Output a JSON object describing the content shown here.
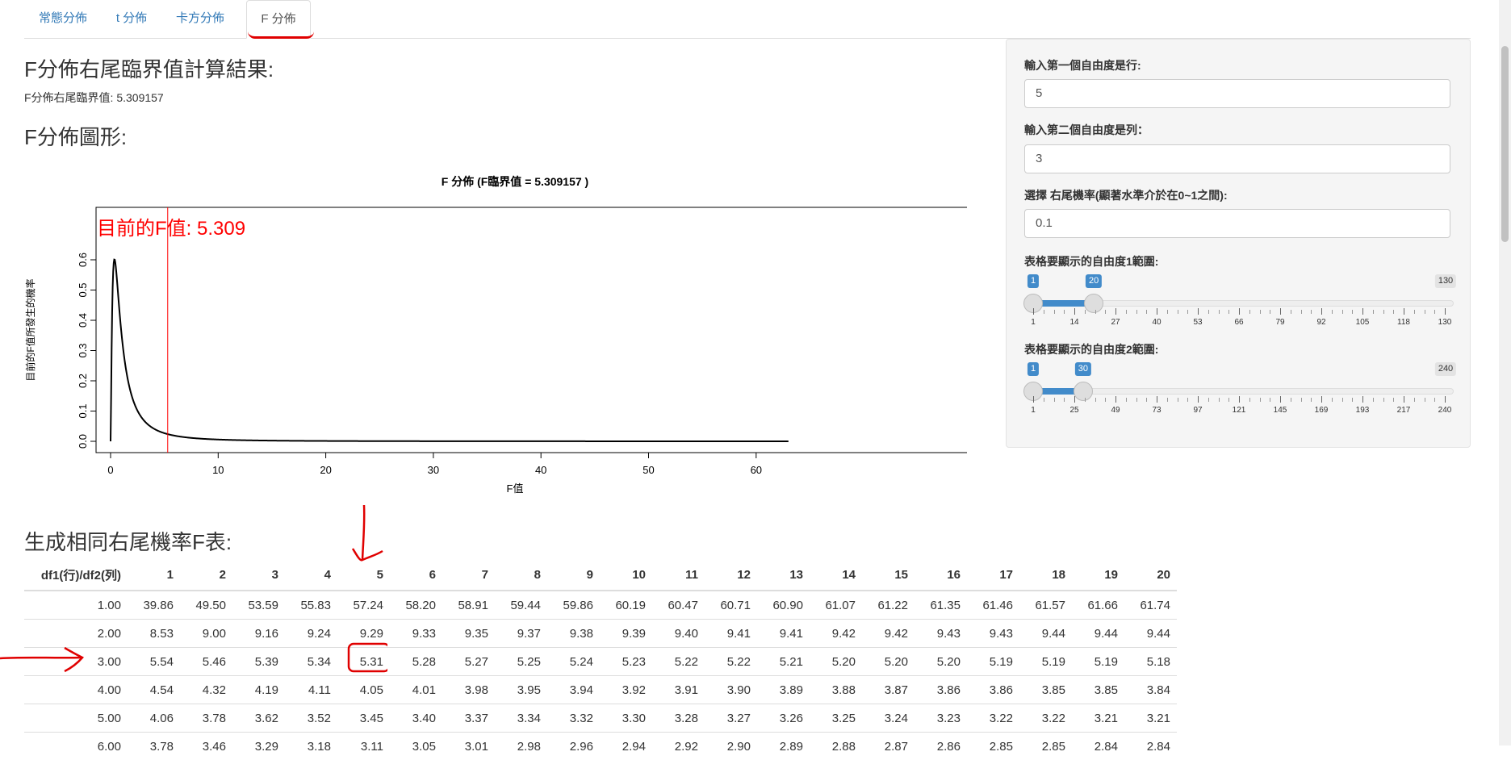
{
  "tabs": [
    {
      "label": "常態分佈"
    },
    {
      "label": "t 分佈"
    },
    {
      "label": "卡方分佈"
    },
    {
      "label": "F 分佈",
      "active": true
    }
  ],
  "main": {
    "result_heading": "F分佈右尾臨界值計算結果:",
    "result_text": "F分佈右尾臨界值: 5.309157",
    "plot_heading": "F分佈圖形:",
    "table_heading": "生成相同右尾機率F表:"
  },
  "chart_data": {
    "type": "line",
    "title": "F 分佈 (F臨界值 = 5.309157 )",
    "xlabel": "F值",
    "ylabel": "目前的F值所發生的機率",
    "annotation": "目前的F值: 5.309",
    "critical_value": 5.309157,
    "df1": 5,
    "df2": 3,
    "xlim": [
      0,
      63
    ],
    "ylim": [
      0,
      0.6
    ],
    "xticks": [
      0,
      10,
      20,
      30,
      40,
      50,
      60
    ],
    "yticks": [
      0.0,
      0.1,
      0.2,
      0.3,
      0.4,
      0.5,
      0.6
    ],
    "curve_color": "#000000",
    "line_color": "#ff0000"
  },
  "sidebar": {
    "df1_label": "輸入第一個自由度是行:",
    "df1_value": "5",
    "df2_label": "輸入第二個自由度是列：",
    "df2_value": "3",
    "prob_label": "選擇 右尾機率(顯著水準介於在0~1之間):",
    "prob_value": "0.1",
    "slider1": {
      "label": "表格要顯示的自由度1範圍:",
      "min": 1,
      "max": 130,
      "from": 1,
      "to": 20,
      "ticks": [
        "1",
        "14",
        "27",
        "40",
        "53",
        "66",
        "79",
        "92",
        "105",
        "118",
        "130"
      ]
    },
    "slider2": {
      "label": "表格要顯示的自由度2範圍:",
      "min": 1,
      "max": 240,
      "from": 1,
      "to": 30,
      "ticks": [
        "1",
        "25",
        "49",
        "73",
        "97",
        "121",
        "145",
        "169",
        "193",
        "217",
        "240"
      ]
    }
  },
  "table": {
    "header": [
      "df1(行)/df2(列)",
      "1",
      "2",
      "3",
      "4",
      "5",
      "6",
      "7",
      "8",
      "9",
      "10",
      "11",
      "12",
      "13",
      "14",
      "15",
      "16",
      "17",
      "18",
      "19",
      "20"
    ],
    "rows": [
      [
        "1.00",
        "39.86",
        "49.50",
        "53.59",
        "55.83",
        "57.24",
        "58.20",
        "58.91",
        "59.44",
        "59.86",
        "60.19",
        "60.47",
        "60.71",
        "60.90",
        "61.07",
        "61.22",
        "61.35",
        "61.46",
        "61.57",
        "61.66",
        "61.74"
      ],
      [
        "2.00",
        "8.53",
        "9.00",
        "9.16",
        "9.24",
        "9.29",
        "9.33",
        "9.35",
        "9.37",
        "9.38",
        "9.39",
        "9.40",
        "9.41",
        "9.41",
        "9.42",
        "9.42",
        "9.43",
        "9.43",
        "9.44",
        "9.44",
        "9.44"
      ],
      [
        "3.00",
        "5.54",
        "5.46",
        "5.39",
        "5.34",
        "5.31",
        "5.28",
        "5.27",
        "5.25",
        "5.24",
        "5.23",
        "5.22",
        "5.22",
        "5.21",
        "5.20",
        "5.20",
        "5.20",
        "5.19",
        "5.19",
        "5.19",
        "5.18"
      ],
      [
        "4.00",
        "4.54",
        "4.32",
        "4.19",
        "4.11",
        "4.05",
        "4.01",
        "3.98",
        "3.95",
        "3.94",
        "3.92",
        "3.91",
        "3.90",
        "3.89",
        "3.88",
        "3.87",
        "3.86",
        "3.86",
        "3.85",
        "3.85",
        "3.84"
      ],
      [
        "5.00",
        "4.06",
        "3.78",
        "3.62",
        "3.52",
        "3.45",
        "3.40",
        "3.37",
        "3.34",
        "3.32",
        "3.30",
        "3.28",
        "3.27",
        "3.26",
        "3.25",
        "3.24",
        "3.23",
        "3.22",
        "3.22",
        "3.21",
        "3.21"
      ],
      [
        "6.00",
        "3.78",
        "3.46",
        "3.29",
        "3.18",
        "3.11",
        "3.05",
        "3.01",
        "2.98",
        "2.96",
        "2.94",
        "2.92",
        "2.90",
        "2.89",
        "2.88",
        "2.87",
        "2.86",
        "2.85",
        "2.85",
        "2.84",
        "2.84"
      ]
    ]
  },
  "colors": {
    "accent": "#428bca",
    "link": "#337ab7",
    "markup": "#e00000"
  }
}
